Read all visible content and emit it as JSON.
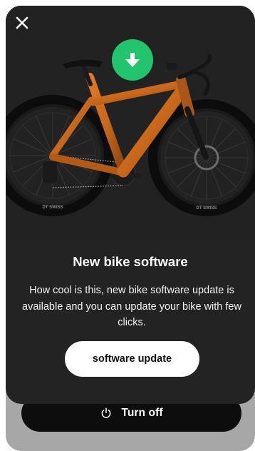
{
  "modal": {
    "title": "New bike software",
    "description": "How cool is this, new bike software update is available and you can update your bike with few clicks.",
    "update_button_label": "software update",
    "close_icon": "close-icon",
    "badge_icon": "download-arrow-icon",
    "hero_image": {
      "tire_brand_text": "DT SWISS"
    }
  },
  "background_screen": {
    "turn_off_label": "Turn off",
    "power_icon": "power-icon"
  },
  "colors": {
    "modal_bg": "#232323",
    "accent_green": "#22c46e",
    "button_white": "#ffffff",
    "frame_orange": "#c8681c"
  }
}
